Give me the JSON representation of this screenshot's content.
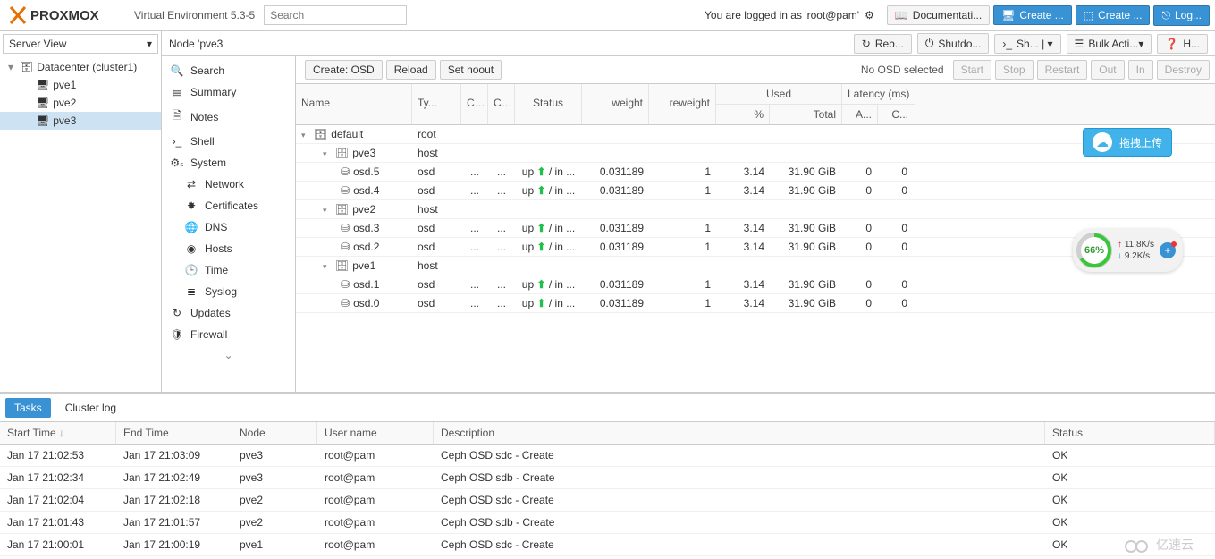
{
  "header": {
    "version": "Virtual Environment 5.3-5",
    "search_placeholder": "Search",
    "login_text": "You are logged in as 'root@pam'",
    "doc_btn": "Documentati...",
    "create_vm_btn": "Create ...",
    "create_ct_btn": "Create ...",
    "logout_btn": "Log..."
  },
  "left": {
    "view_selector": "Server View",
    "datacenter": "Datacenter (cluster1)",
    "nodes": [
      "pve1",
      "pve2",
      "pve3"
    ]
  },
  "crumb": {
    "title": "Node 'pve3'",
    "reboot": "Reb...",
    "shutdown": "Shutdo...",
    "shell": "Sh...",
    "bulk": "Bulk Acti...",
    "help": "H..."
  },
  "sidenav": [
    {
      "icon": "search",
      "label": "Search"
    },
    {
      "icon": "summary",
      "label": "Summary"
    },
    {
      "icon": "notes",
      "label": "Notes"
    },
    {
      "icon": "shell",
      "label": "Shell"
    },
    {
      "icon": "cogs",
      "label": "System"
    },
    {
      "icon": "net",
      "label": "Network",
      "sub": true
    },
    {
      "icon": "cert",
      "label": "Certificates",
      "sub": true
    },
    {
      "icon": "dns",
      "label": "DNS",
      "sub": true
    },
    {
      "icon": "hosts",
      "label": "Hosts",
      "sub": true
    },
    {
      "icon": "time",
      "label": "Time",
      "sub": true
    },
    {
      "icon": "syslog",
      "label": "Syslog",
      "sub": true
    },
    {
      "icon": "updates",
      "label": "Updates"
    },
    {
      "icon": "firewall",
      "label": "Firewall"
    }
  ],
  "toolbar": {
    "create_osd": "Create: OSD",
    "reload": "Reload",
    "set_noout": "Set noout",
    "no_sel": "No OSD selected",
    "start": "Start",
    "stop": "Stop",
    "restart": "Restart",
    "out": "Out",
    "in": "In",
    "destroy": "Destroy"
  },
  "grid_headers": {
    "name": "Name",
    "type": "Ty...",
    "c1": "C...",
    "c2": "C...",
    "status": "Status",
    "weight": "weight",
    "reweight": "reweight",
    "used": "Used",
    "pct": "%",
    "total": "Total",
    "latency": "Latency (ms)",
    "la": "A...",
    "lc": "C..."
  },
  "osd_tree": [
    {
      "name": "default",
      "type": "root",
      "kind": "root"
    },
    {
      "name": "pve3",
      "type": "host",
      "kind": "host"
    },
    {
      "name": "osd.5",
      "type": "osd",
      "kind": "osd",
      "c1": "...",
      "c2": "...",
      "status": "up / in ...",
      "weight": "0.031189",
      "reweight": "1",
      "pct": "3.14",
      "total": "31.90 GiB",
      "la": "0",
      "lc": "0"
    },
    {
      "name": "osd.4",
      "type": "osd",
      "kind": "osd",
      "c1": "...",
      "c2": "...",
      "status": "up / in ...",
      "weight": "0.031189",
      "reweight": "1",
      "pct": "3.14",
      "total": "31.90 GiB",
      "la": "0",
      "lc": "0"
    },
    {
      "name": "pve2",
      "type": "host",
      "kind": "host"
    },
    {
      "name": "osd.3",
      "type": "osd",
      "kind": "osd",
      "c1": "...",
      "c2": "...",
      "status": "up / in ...",
      "weight": "0.031189",
      "reweight": "1",
      "pct": "3.14",
      "total": "31.90 GiB",
      "la": "0",
      "lc": "0"
    },
    {
      "name": "osd.2",
      "type": "osd",
      "kind": "osd",
      "c1": "...",
      "c2": "...",
      "status": "up / in ...",
      "weight": "0.031189",
      "reweight": "1",
      "pct": "3.14",
      "total": "31.90 GiB",
      "la": "0",
      "lc": "0"
    },
    {
      "name": "pve1",
      "type": "host",
      "kind": "host"
    },
    {
      "name": "osd.1",
      "type": "osd",
      "kind": "osd",
      "c1": "...",
      "c2": "...",
      "status": "up / in ...",
      "weight": "0.031189",
      "reweight": "1",
      "pct": "3.14",
      "total": "31.90 GiB",
      "la": "0",
      "lc": "0"
    },
    {
      "name": "osd.0",
      "type": "osd",
      "kind": "osd",
      "c1": "...",
      "c2": "...",
      "status": "up / in ...",
      "weight": "0.031189",
      "reweight": "1",
      "pct": "3.14",
      "total": "31.90 GiB",
      "la": "0",
      "lc": "0"
    }
  ],
  "tabs": {
    "tasks": "Tasks",
    "cluster_log": "Cluster log"
  },
  "log_headers": {
    "start": "Start Time",
    "end": "End Time",
    "node": "Node",
    "user": "User name",
    "desc": "Description",
    "status": "Status"
  },
  "log_rows": [
    {
      "start": "Jan 17 21:02:53",
      "end": "Jan 17 21:03:09",
      "node": "pve3",
      "user": "root@pam",
      "desc": "Ceph OSD sdc - Create",
      "status": "OK"
    },
    {
      "start": "Jan 17 21:02:34",
      "end": "Jan 17 21:02:49",
      "node": "pve3",
      "user": "root@pam",
      "desc": "Ceph OSD sdb - Create",
      "status": "OK"
    },
    {
      "start": "Jan 17 21:02:04",
      "end": "Jan 17 21:02:18",
      "node": "pve2",
      "user": "root@pam",
      "desc": "Ceph OSD sdc - Create",
      "status": "OK"
    },
    {
      "start": "Jan 17 21:01:43",
      "end": "Jan 17 21:01:57",
      "node": "pve2",
      "user": "root@pam",
      "desc": "Ceph OSD sdb - Create",
      "status": "OK"
    },
    {
      "start": "Jan 17 21:00:01",
      "end": "Jan 17 21:00:19",
      "node": "pve1",
      "user": "root@pam",
      "desc": "Ceph OSD sdc - Create",
      "status": "OK"
    }
  ],
  "float": {
    "upload": "拖拽上传",
    "gauge_pct": "66%",
    "up_speed": "11.8K/s",
    "down_speed": "9.2K/s"
  },
  "watermark": "亿速云"
}
